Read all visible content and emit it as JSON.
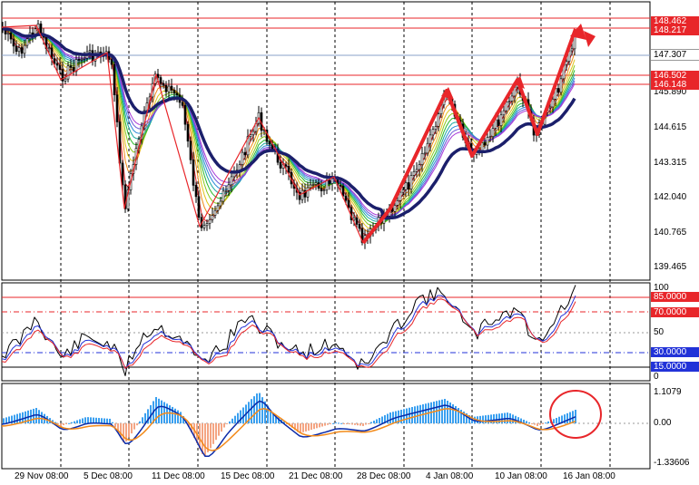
{
  "chart_data": [
    {
      "type": "line",
      "panel": "price",
      "y_ticks": [
        "145.890",
        "144.615",
        "143.315",
        "142.040",
        "140.765",
        "139.465"
      ],
      "level_tags": [
        {
          "label": "148.462",
          "color": "#e8262a"
        },
        {
          "label": "148.217",
          "color": "#e8262a"
        },
        {
          "label": "147.307",
          "color": "#ffffff",
          "text_color": "#000000"
        },
        {
          "label": "146.502",
          "color": "#e8262a"
        },
        {
          "label": "146.148",
          "color": "#e8262a"
        }
      ],
      "ylim": [
        139.465,
        148.462
      ],
      "series": [
        {
          "color": "#1b1f6b",
          "close_approx": [
            148.0,
            147.0,
            146.6,
            145.6,
            145.4,
            144.3,
            143.4,
            143.0,
            142.9,
            142.6,
            142.3,
            142.0,
            142.6,
            143.6,
            144.6,
            145.4,
            146.5
          ]
        }
      ],
      "annotation": "zigzag arrows (red)"
    },
    {
      "type": "line",
      "panel": "oscillator",
      "y_ticks": [
        "100",
        "50",
        "0"
      ],
      "level_tags": [
        {
          "label": "85.0000",
          "color": "#e8262a"
        },
        {
          "label": "70.0000",
          "color": "#e8262a"
        },
        {
          "label": "30.0000",
          "color": "#2232d8"
        },
        {
          "label": "15.0000",
          "color": "#2232d8"
        }
      ],
      "ylim": [
        0,
        100
      ]
    },
    {
      "type": "bar",
      "panel": "macd",
      "y_ticks": [
        "1.1079",
        "0.00",
        "-1.33606"
      ],
      "ylim": [
        -1.33606,
        1.1079
      ]
    }
  ],
  "x_axis": {
    "labels": [
      "29 Nov 08:00",
      "5 Dec 08:00",
      "11 Dec 08:00",
      "15 Dec 08:00",
      "21 Dec 08:00",
      "28 Dec 08:00",
      "4 Jan 08:00",
      "10 Jan 08:00",
      "16 Jan 08:00"
    ]
  },
  "colors": {
    "up_arrow": "#e8262a",
    "ma_main": "#1b1f6b",
    "hist_pos": "#3aa0f0",
    "hist_neg": "#f4a583",
    "macd_line": "#0b2aa8",
    "signal_line": "#f38a1a"
  }
}
